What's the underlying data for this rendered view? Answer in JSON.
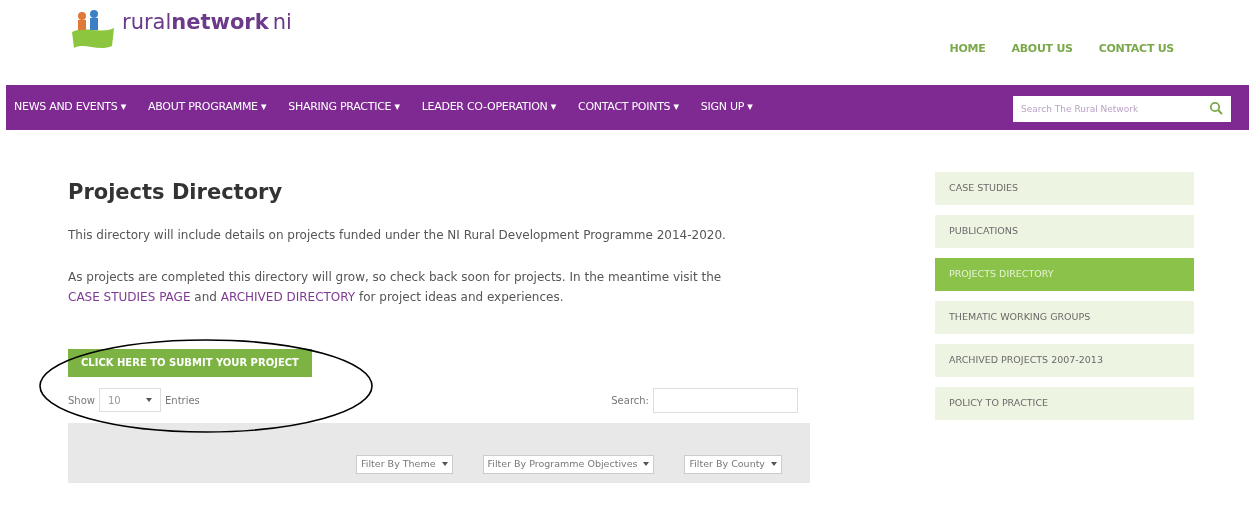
{
  "logo": {
    "text_light": "rural",
    "text_bold": "network",
    "text_suffix": "ni"
  },
  "top_links": [
    "HOME",
    "ABOUT US",
    "CONTACT US"
  ],
  "nav": {
    "items": [
      {
        "label": "NEWS AND EVENTS",
        "caret": "▾"
      },
      {
        "label": "ABOUT PROGRAMME",
        "caret": "▾"
      },
      {
        "label": "SHARING PRACTICE",
        "caret": "▾"
      },
      {
        "label": "LEADER CO-OPERATION",
        "caret": "▾"
      },
      {
        "label": "CONTACT POINTS",
        "caret": "▾"
      },
      {
        "label": "SIGN UP",
        "caret": "▾"
      }
    ],
    "search": {
      "placeholder": "Search The Rural Network"
    }
  },
  "page": {
    "title": "Projects Directory",
    "paragraphs": [
      {
        "parts": [
          {
            "text": "This directory will include details on projects funded under the NI Rural Development Programme 2014-2020.",
            "kind": "text"
          }
        ]
      },
      {
        "parts": [
          {
            "text": "As projects are completed this directory will grow, so check back soon for projects. In the meantime visit the ",
            "kind": "text"
          },
          {
            "text": "CASE STUDIES PAGE",
            "kind": "link"
          },
          {
            "text": " and ",
            "kind": "text"
          },
          {
            "text": "ARCHIVED DIRECTORY",
            "kind": "link"
          },
          {
            "text": " for project ideas and experiences.",
            "kind": "text"
          }
        ]
      }
    ],
    "submit_button": "CLICK HERE TO SUBMIT YOUR PROJECT",
    "annotation": {
      "kind": "ellipse"
    },
    "table_controls": {
      "show_label": "Show",
      "entries_value": "10",
      "entries_label": "Entries",
      "search_label": "Search:"
    },
    "filters": [
      "Filter By Theme",
      "Filter By Programme Objectives",
      "Filter By County"
    ]
  },
  "sidebar": {
    "items": [
      {
        "label": "CASE STUDIES",
        "selected": false
      },
      {
        "label": "PUBLICATIONS",
        "selected": false
      },
      {
        "label": "PROJECTS DIRECTORY",
        "selected": true
      },
      {
        "label": "THEMATIC WORKING GROUPS",
        "selected": false
      },
      {
        "label": "ARCHIVED PROJECTS 2007-2013",
        "selected": false
      },
      {
        "label": "POLICY TO PRACTICE",
        "selected": false
      }
    ]
  }
}
